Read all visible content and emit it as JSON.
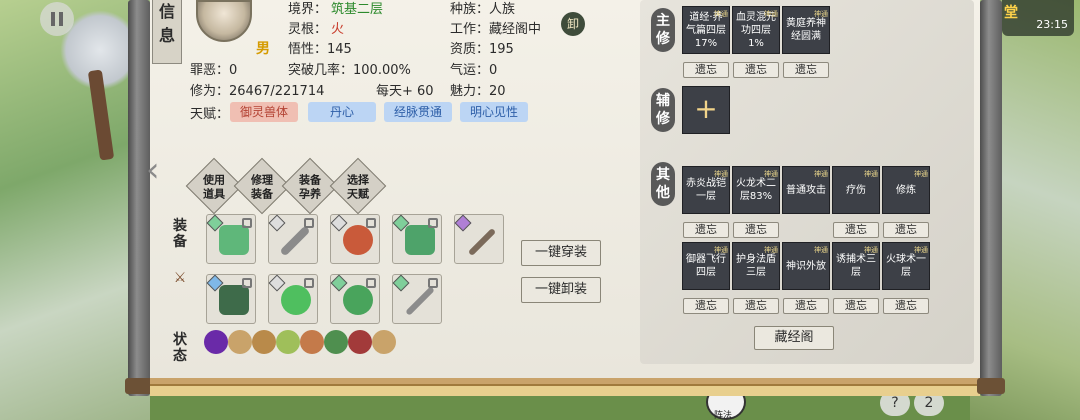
{
  "hud": {
    "tag": "堂",
    "clock": "23:15",
    "page_num": "2",
    "panda_label": "阵法"
  },
  "info_tab": [
    "信",
    "息"
  ],
  "profile": {
    "gender": "男",
    "realm_label": "境界：",
    "realm_value": "筑基二层",
    "root_label": "灵根：",
    "root_value": "火",
    "comprehension": "悟性：145",
    "race": "种族：人族",
    "work": "工作：藏经阁中",
    "aptitude": "资质：195",
    "karma": "罪恶：0",
    "breakthrough": "突破几率：100.00%",
    "luck": "气运：0",
    "cultivation": "修为：26467/221714",
    "daily_gain": "每天+ 60",
    "charm": "魅力：20",
    "seal": "卸"
  },
  "talents": {
    "label": "天赋：",
    "items": [
      "御灵兽体",
      "丹心",
      "经脉贯通",
      "明心见性"
    ]
  },
  "actions": [
    {
      "label": "使用道具"
    },
    {
      "label": "修理装备"
    },
    {
      "label": "装备孕养"
    },
    {
      "label": "选择天赋"
    }
  ],
  "equip_label": [
    "装",
    "备"
  ],
  "status_label": [
    "状",
    "态"
  ],
  "equip_buttons": {
    "wear_all": "一键穿装",
    "remove_all": "一键卸装"
  },
  "skills": {
    "main_label": [
      "主",
      "修"
    ],
    "aux_label": [
      "辅",
      "修"
    ],
    "other_label": [
      "其",
      "他"
    ],
    "main": [
      "道经·养气篇四层 17%",
      "血灵混元功四层 1%",
      "黄庭养神经圆满"
    ],
    "other_row1": [
      "赤炎战铠一层",
      "火龙术二层83%",
      "普通攻击",
      "疗伤",
      "修炼"
    ],
    "other_row2": [
      "御器飞行四层",
      "护身法盾三层",
      "神识外放",
      "诱捕术三层",
      "火球术一层"
    ],
    "corner_tag": "神通",
    "forget": "遗忘",
    "add": "+",
    "library": "藏经阁"
  }
}
